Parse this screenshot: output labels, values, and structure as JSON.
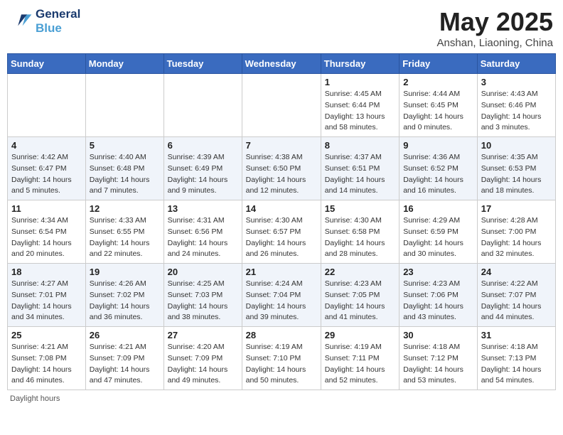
{
  "header": {
    "logo_line1": "General",
    "logo_line2": "Blue",
    "month": "May 2025",
    "location": "Anshan, Liaoning, China"
  },
  "days_of_week": [
    "Sunday",
    "Monday",
    "Tuesday",
    "Wednesday",
    "Thursday",
    "Friday",
    "Saturday"
  ],
  "weeks": [
    [
      {
        "day": "",
        "info": ""
      },
      {
        "day": "",
        "info": ""
      },
      {
        "day": "",
        "info": ""
      },
      {
        "day": "",
        "info": ""
      },
      {
        "day": "1",
        "info": "Sunrise: 4:45 AM\nSunset: 6:44 PM\nDaylight: 13 hours\nand 58 minutes."
      },
      {
        "day": "2",
        "info": "Sunrise: 4:44 AM\nSunset: 6:45 PM\nDaylight: 14 hours\nand 0 minutes."
      },
      {
        "day": "3",
        "info": "Sunrise: 4:43 AM\nSunset: 6:46 PM\nDaylight: 14 hours\nand 3 minutes."
      }
    ],
    [
      {
        "day": "4",
        "info": "Sunrise: 4:42 AM\nSunset: 6:47 PM\nDaylight: 14 hours\nand 5 minutes."
      },
      {
        "day": "5",
        "info": "Sunrise: 4:40 AM\nSunset: 6:48 PM\nDaylight: 14 hours\nand 7 minutes."
      },
      {
        "day": "6",
        "info": "Sunrise: 4:39 AM\nSunset: 6:49 PM\nDaylight: 14 hours\nand 9 minutes."
      },
      {
        "day": "7",
        "info": "Sunrise: 4:38 AM\nSunset: 6:50 PM\nDaylight: 14 hours\nand 12 minutes."
      },
      {
        "day": "8",
        "info": "Sunrise: 4:37 AM\nSunset: 6:51 PM\nDaylight: 14 hours\nand 14 minutes."
      },
      {
        "day": "9",
        "info": "Sunrise: 4:36 AM\nSunset: 6:52 PM\nDaylight: 14 hours\nand 16 minutes."
      },
      {
        "day": "10",
        "info": "Sunrise: 4:35 AM\nSunset: 6:53 PM\nDaylight: 14 hours\nand 18 minutes."
      }
    ],
    [
      {
        "day": "11",
        "info": "Sunrise: 4:34 AM\nSunset: 6:54 PM\nDaylight: 14 hours\nand 20 minutes."
      },
      {
        "day": "12",
        "info": "Sunrise: 4:33 AM\nSunset: 6:55 PM\nDaylight: 14 hours\nand 22 minutes."
      },
      {
        "day": "13",
        "info": "Sunrise: 4:31 AM\nSunset: 6:56 PM\nDaylight: 14 hours\nand 24 minutes."
      },
      {
        "day": "14",
        "info": "Sunrise: 4:30 AM\nSunset: 6:57 PM\nDaylight: 14 hours\nand 26 minutes."
      },
      {
        "day": "15",
        "info": "Sunrise: 4:30 AM\nSunset: 6:58 PM\nDaylight: 14 hours\nand 28 minutes."
      },
      {
        "day": "16",
        "info": "Sunrise: 4:29 AM\nSunset: 6:59 PM\nDaylight: 14 hours\nand 30 minutes."
      },
      {
        "day": "17",
        "info": "Sunrise: 4:28 AM\nSunset: 7:00 PM\nDaylight: 14 hours\nand 32 minutes."
      }
    ],
    [
      {
        "day": "18",
        "info": "Sunrise: 4:27 AM\nSunset: 7:01 PM\nDaylight: 14 hours\nand 34 minutes."
      },
      {
        "day": "19",
        "info": "Sunrise: 4:26 AM\nSunset: 7:02 PM\nDaylight: 14 hours\nand 36 minutes."
      },
      {
        "day": "20",
        "info": "Sunrise: 4:25 AM\nSunset: 7:03 PM\nDaylight: 14 hours\nand 38 minutes."
      },
      {
        "day": "21",
        "info": "Sunrise: 4:24 AM\nSunset: 7:04 PM\nDaylight: 14 hours\nand 39 minutes."
      },
      {
        "day": "22",
        "info": "Sunrise: 4:23 AM\nSunset: 7:05 PM\nDaylight: 14 hours\nand 41 minutes."
      },
      {
        "day": "23",
        "info": "Sunrise: 4:23 AM\nSunset: 7:06 PM\nDaylight: 14 hours\nand 43 minutes."
      },
      {
        "day": "24",
        "info": "Sunrise: 4:22 AM\nSunset: 7:07 PM\nDaylight: 14 hours\nand 44 minutes."
      }
    ],
    [
      {
        "day": "25",
        "info": "Sunrise: 4:21 AM\nSunset: 7:08 PM\nDaylight: 14 hours\nand 46 minutes."
      },
      {
        "day": "26",
        "info": "Sunrise: 4:21 AM\nSunset: 7:09 PM\nDaylight: 14 hours\nand 47 minutes."
      },
      {
        "day": "27",
        "info": "Sunrise: 4:20 AM\nSunset: 7:09 PM\nDaylight: 14 hours\nand 49 minutes."
      },
      {
        "day": "28",
        "info": "Sunrise: 4:19 AM\nSunset: 7:10 PM\nDaylight: 14 hours\nand 50 minutes."
      },
      {
        "day": "29",
        "info": "Sunrise: 4:19 AM\nSunset: 7:11 PM\nDaylight: 14 hours\nand 52 minutes."
      },
      {
        "day": "30",
        "info": "Sunrise: 4:18 AM\nSunset: 7:12 PM\nDaylight: 14 hours\nand 53 minutes."
      },
      {
        "day": "31",
        "info": "Sunrise: 4:18 AM\nSunset: 7:13 PM\nDaylight: 14 hours\nand 54 minutes."
      }
    ]
  ],
  "footer": "Daylight hours"
}
